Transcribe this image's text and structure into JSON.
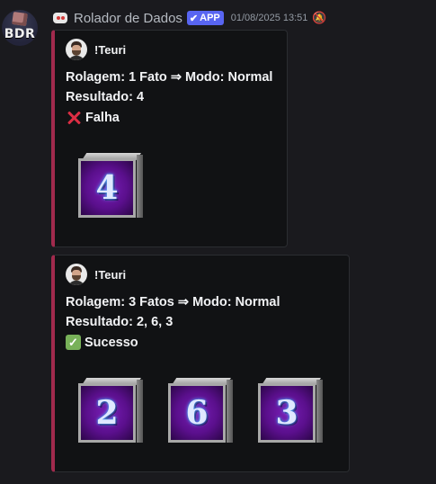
{
  "bot": {
    "avatar_text": "BDR",
    "name": "Rolador de Dados",
    "badge": "APP",
    "badge_check": "✔",
    "timestamp": "01/08/2025 13:51"
  },
  "embeds": [
    {
      "author": "!Teuri",
      "roll_line": "Rolagem: 1 Fato ⇒ Modo: Normal",
      "result_line": "Resultado: 4",
      "status": "Falha",
      "status_type": "fail",
      "dice": [
        "4"
      ]
    },
    {
      "author": "!Teuri",
      "roll_line": "Rolagem: 3 Fatos ⇒ Modo: Normal",
      "result_line": "Resultado: 2, 6, 3",
      "status": "Sucesso",
      "status_type": "success",
      "dice": [
        "2",
        "6",
        "3"
      ]
    }
  ],
  "colors": {
    "embed_accent": "#a12a4d",
    "app_badge": "#5865f2",
    "fail": "#dd2e44",
    "success": "#78b159",
    "die_face": "#5a0f8c"
  },
  "icons": {
    "header": "bot-icon",
    "bell": "bell-silent-icon",
    "fail": "cross-mark-icon",
    "success": "check-box-icon"
  }
}
